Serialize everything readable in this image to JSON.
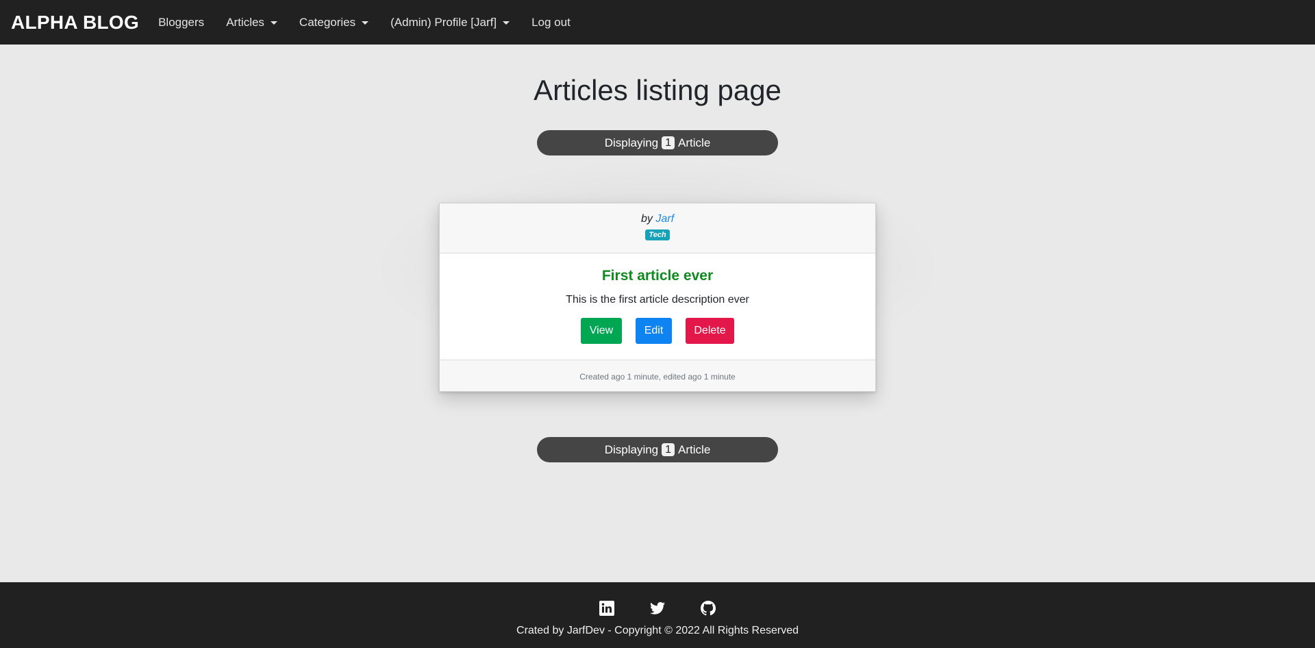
{
  "navbar": {
    "brand": "ALPHA BLOG",
    "items": [
      {
        "label": "Bloggers",
        "dropdown": false
      },
      {
        "label": "Articles",
        "dropdown": true
      },
      {
        "label": "Categories",
        "dropdown": true
      },
      {
        "label": "(Admin) Profile [Jarf]",
        "dropdown": true
      },
      {
        "label": "Log out",
        "dropdown": false
      }
    ]
  },
  "main": {
    "title": "Articles listing page",
    "display_prefix": "Displaying",
    "display_count": "1",
    "display_suffix": "Article"
  },
  "article": {
    "by": "by",
    "author": "Jarf",
    "category": "Tech",
    "title": "First article ever",
    "description": "This is the first article description ever",
    "buttons": {
      "view": "View",
      "edit": "Edit",
      "delete": "Delete"
    },
    "timestamps": "Created ago 1 minute, edited ago 1 minute"
  },
  "footer": {
    "social": [
      "linkedin-icon",
      "twitter-icon",
      "github-icon"
    ],
    "copyright": "Crated by JarfDev - Copyright © 2022 All Rights Reserved"
  },
  "colors": {
    "navbar_bg": "#212121",
    "page_bg": "#e9e9e9",
    "title_green": "#0e8a1f",
    "view_green": "#00a651",
    "edit_blue": "#0d84f2",
    "delete_red": "#e3174a",
    "badge_teal": "#17a2b8",
    "pill_bg": "#454545"
  }
}
